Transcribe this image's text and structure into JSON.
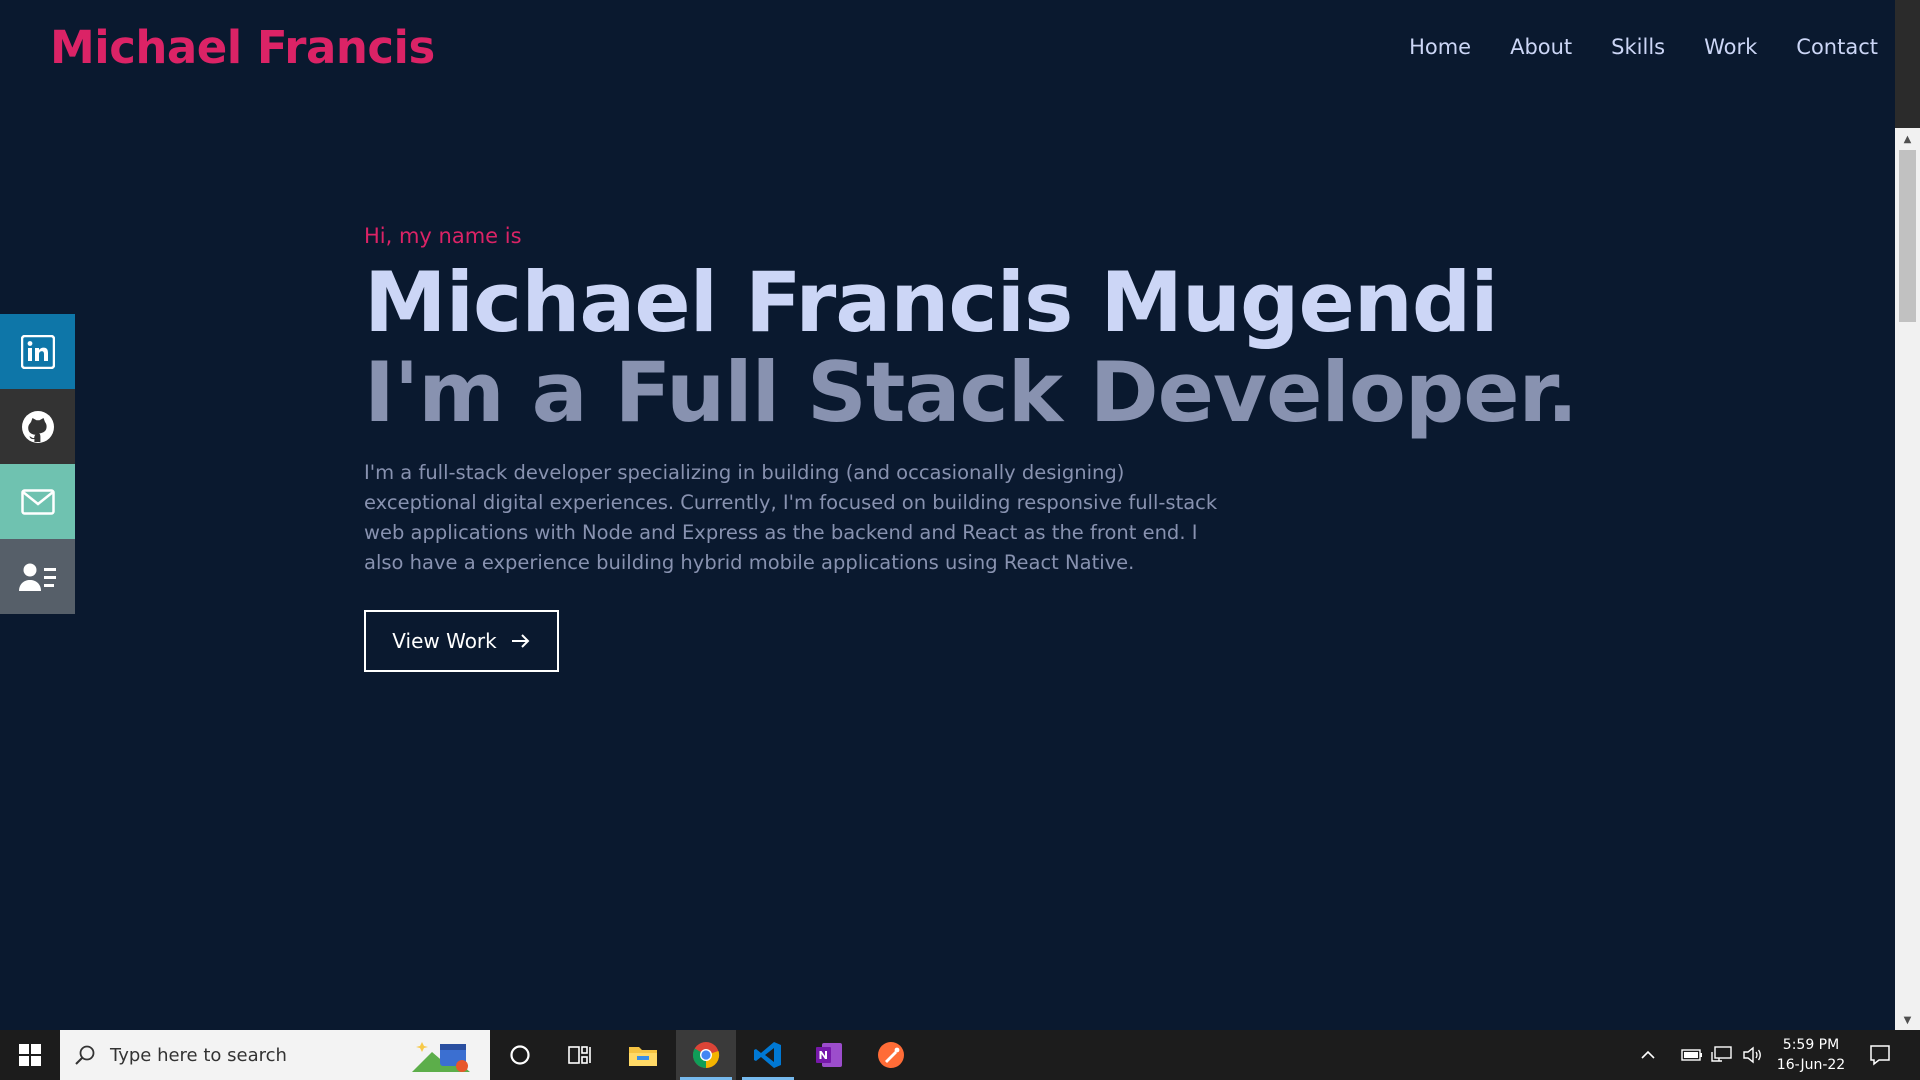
{
  "brand": {
    "logo_text": "Michael Francis",
    "accent_color": "#db2366",
    "background_color": "#0a192f"
  },
  "nav": {
    "items": [
      {
        "label": "Home"
      },
      {
        "label": "About"
      },
      {
        "label": "Skills"
      },
      {
        "label": "Work"
      },
      {
        "label": "Contact"
      }
    ]
  },
  "social": {
    "items": [
      {
        "icon": "linkedin-icon",
        "color": "#0e76a8"
      },
      {
        "icon": "github-icon",
        "color": "#333333"
      },
      {
        "icon": "mail-icon",
        "color": "#6fc2b0"
      },
      {
        "icon": "resume-icon",
        "color": "#565f69"
      }
    ]
  },
  "hero": {
    "greeting": "Hi, my name is",
    "name": "Michael Francis Mugendi",
    "role": "I'm a Full Stack Developer.",
    "description": "I'm a full-stack developer specializing in building (and occasionally designing) exceptional digital experiences. Currently, I'm focused on building responsive full-stack web applications with Node and Express as the backend and React as the front end. I also have a experience building hybrid mobile applications using React Native.",
    "cta_label": "View Work",
    "cta_icon": "arrow-right-icon"
  },
  "taskbar": {
    "search_placeholder": "Type here to search",
    "time": "5:59 PM",
    "date": "16-Jun-22",
    "apps": [
      {
        "icon": "cortana-icon"
      },
      {
        "icon": "task-view-icon"
      },
      {
        "icon": "file-explorer-icon"
      },
      {
        "icon": "chrome-icon"
      },
      {
        "icon": "vscode-icon"
      },
      {
        "icon": "onenote-icon"
      },
      {
        "icon": "postman-icon"
      }
    ]
  }
}
